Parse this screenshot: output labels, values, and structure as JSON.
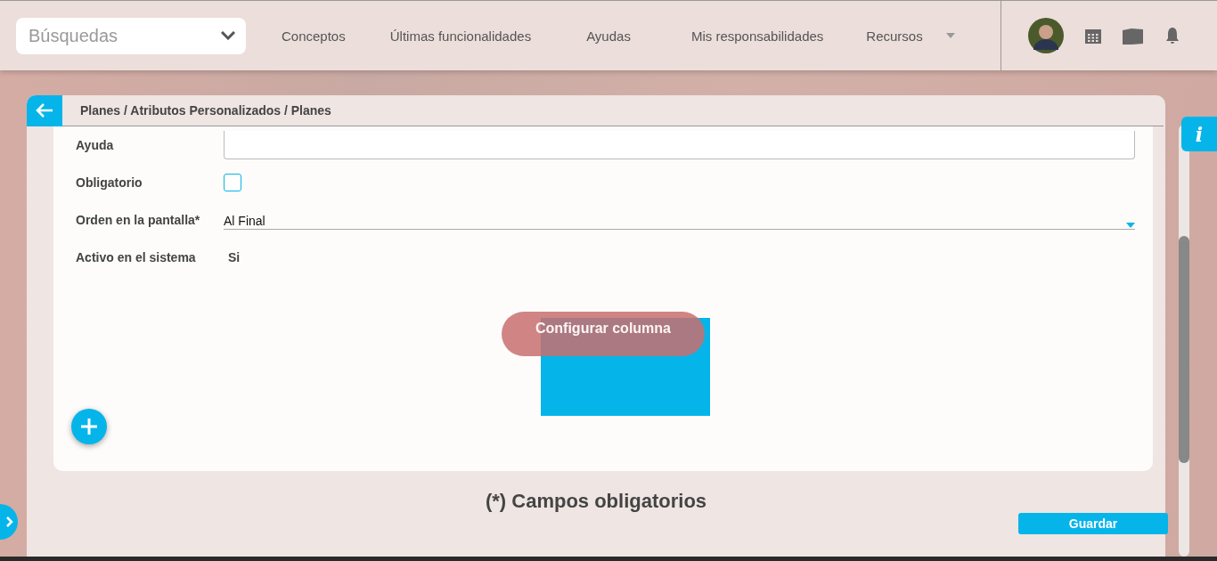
{
  "search": {
    "placeholder": "Búsquedas"
  },
  "nav": [
    {
      "label": "Conceptos",
      "has_menu": false
    },
    {
      "label": "Últimas funcionalidades",
      "has_menu": false
    },
    {
      "label": "Ayudas",
      "has_menu": false
    },
    {
      "label": "Mis responsabilidades",
      "has_menu": false
    },
    {
      "label": "Recursos",
      "has_menu": true
    }
  ],
  "breadcrumb": "Planes / Atributos Personalizados / Planes",
  "info_tab": "i",
  "form": [
    {
      "kind": "textarea",
      "label": "Ayuda"
    },
    {
      "kind": "checkbox",
      "label": "Obligatorio",
      "checked": false
    },
    {
      "kind": "select",
      "label": "Orden en la pantalla*",
      "value": "Al Final"
    },
    {
      "kind": "text",
      "label": "Activo en el sistema",
      "value": "Si"
    }
  ],
  "configure_button": "Configurar columna",
  "required_note": "(*) Campos obligatorios",
  "save_button": "Guardar"
}
